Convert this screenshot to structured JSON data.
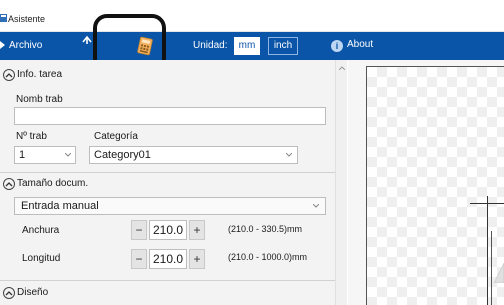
{
  "window": {
    "title": "Asistente"
  },
  "toolbar": {
    "file_menu": "Archivo",
    "unit_label": "Unidad:",
    "units": [
      "mm",
      "inch"
    ],
    "selected_unit": "mm",
    "about": "About",
    "about_icon_glyph": "i"
  },
  "job_info": {
    "header": "Info. tarea",
    "job_name_label": "Nomb trab",
    "job_name_value": "",
    "job_no_label": "Nº trab",
    "job_no_value": "1",
    "category_label": "Categoría",
    "category_value": "Category01"
  },
  "doc_size": {
    "header": "Tamaño docum.",
    "mode_value": "Entrada manual",
    "width_label": "Anchura",
    "width_value": "210.0",
    "width_range": "(210.0 - 330.5)mm",
    "length_label": "Longitud",
    "length_value": "210.0",
    "length_range": "(210.0 - 1000.0)mm",
    "minus_glyph": "−",
    "plus_glyph": "+"
  },
  "design": {
    "header": "Diseño"
  },
  "colors": {
    "toolbar_bg": "#0a55a8",
    "panel_bg": "#f3f3f3",
    "highlight_ring": "#111111",
    "calculator_icon": "#f2b15e"
  },
  "icons": {
    "app": "app-icon",
    "undo": "undo-arrow-icon",
    "calculator": "calculator-icon",
    "about": "info-icon",
    "collapse": "chevron-up-icon"
  }
}
